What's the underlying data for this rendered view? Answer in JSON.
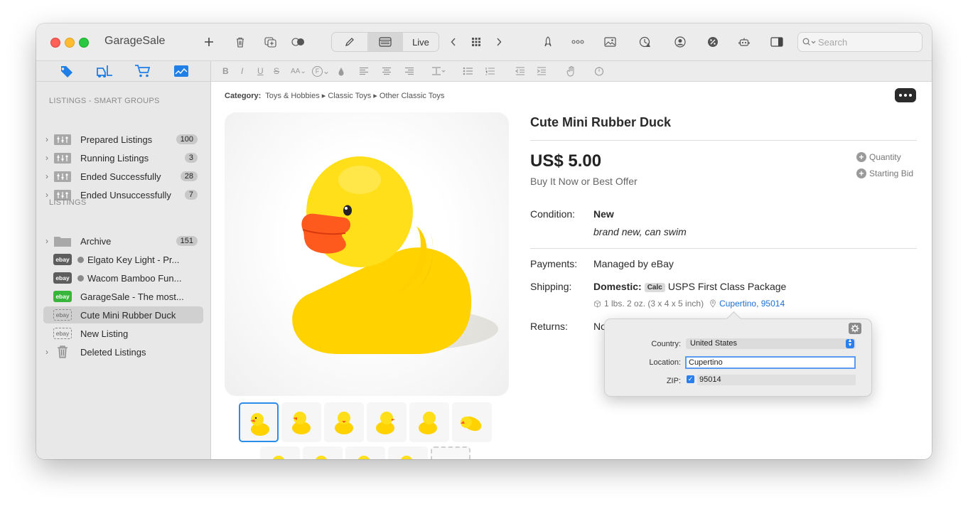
{
  "app": {
    "title": "GarageSale"
  },
  "toolbar": {
    "mode_live": "Live",
    "search_placeholder": "Search"
  },
  "sidebar": {
    "smart_groups_header": "LISTINGS - SMART GROUPS",
    "smart_groups": [
      {
        "label": "Prepared Listings",
        "count": "100"
      },
      {
        "label": "Running Listings",
        "count": "3"
      },
      {
        "label": "Ended Successfully",
        "count": "28"
      },
      {
        "label": "Ended Unsuccessfully",
        "count": "7"
      }
    ],
    "listings_header": "LISTINGS",
    "archive": {
      "label": "Archive",
      "count": "151"
    },
    "listings": [
      {
        "label": "Elgato Key Light - Pr...",
        "badge": "ebay"
      },
      {
        "label": "Wacom Bamboo Fun...",
        "badge": "ebay"
      },
      {
        "label": "GarageSale - The most...",
        "badge": "ebay"
      },
      {
        "label": "Cute Mini Rubber Duck",
        "badge": "ebay"
      },
      {
        "label": "New Listing",
        "badge": "ebay"
      }
    ],
    "deleted": {
      "label": "Deleted Listings"
    }
  },
  "format_bar": {
    "bold": "B",
    "italic": "I",
    "underline": "U",
    "strike": "S",
    "font_size": "AA",
    "font_face": "F"
  },
  "listing": {
    "category_label": "Category:",
    "category_path": "Toys & Hobbies ▸ Classic Toys ▸ Other Classic Toys",
    "title": "Cute Mini Rubber Duck",
    "price": "US$ 5.00",
    "price_format": "Buy It Now or Best Offer",
    "add_quantity": "Quantity",
    "add_starting_bid": "Starting Bid",
    "condition_label": "Condition:",
    "condition_value": "New",
    "condition_note": "brand new, can swim",
    "payments_label": "Payments:",
    "payments_value": "Managed by eBay",
    "shipping_label": "Shipping:",
    "shipping_domestic": "Domestic:",
    "shipping_calc": "Calc",
    "shipping_service": "USPS First Class Package",
    "shipping_weight": "1 lbs. 2 oz. (3 x 4 x 5 inch)",
    "shipping_location": "Cupertino, 95014",
    "returns_label": "Returns:",
    "returns_value_partial": "No"
  },
  "popover": {
    "country_label": "Country:",
    "country_value": "United States",
    "location_label": "Location:",
    "location_value": "Cupertino",
    "zip_label": "ZIP:",
    "zip_value": "95014",
    "zip_checked": true
  },
  "colors": {
    "accent": "#2a7fef",
    "link": "#1d6fd3",
    "duck": "#ffd400",
    "beak": "#ff5a1e"
  }
}
